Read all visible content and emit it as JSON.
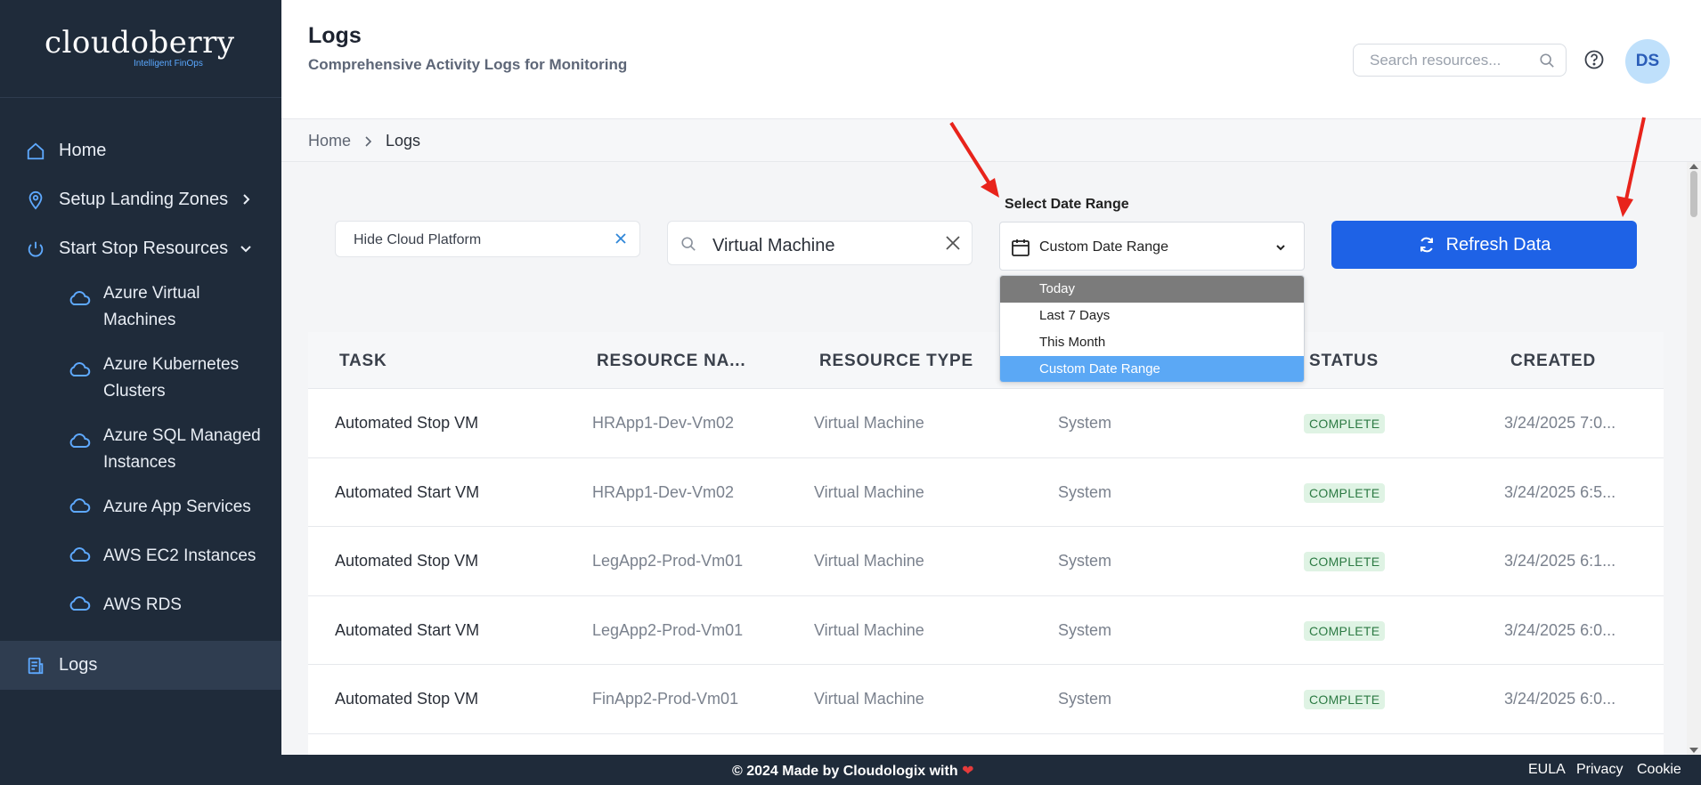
{
  "brand": {
    "name": "cloudoberry",
    "tagline": "Intelligent FinOps"
  },
  "sidebar": {
    "items": [
      {
        "label": "Home",
        "icon": "home-icon"
      },
      {
        "label": "Setup Landing Zones",
        "icon": "location-pin-icon"
      },
      {
        "label": "Start Stop Resources",
        "icon": "power-icon"
      }
    ],
    "sub_items": [
      {
        "label": "Azure Virtual Machines",
        "icon": "cloud-icon"
      },
      {
        "label": "Azure Kubernetes Clusters",
        "icon": "cloud-icon"
      },
      {
        "label": "Azure SQL Managed Instances",
        "icon": "cloud-icon"
      },
      {
        "label": "Azure App Services",
        "icon": "cloud-icon"
      },
      {
        "label": "AWS EC2 Instances",
        "icon": "cloud-icon"
      },
      {
        "label": "AWS RDS",
        "icon": "cloud-icon"
      }
    ],
    "logs": {
      "label": "Logs",
      "icon": "logs-icon",
      "active": true
    }
  },
  "header": {
    "title": "Logs",
    "subtitle": "Comprehensive Activity Logs for Monitoring",
    "search_placeholder": "Search resources...",
    "avatar_initials": "DS"
  },
  "breadcrumb": {
    "home": "Home",
    "current": "Logs"
  },
  "filters": {
    "platform_chip": "Hide Cloud Platform",
    "search_value": "Virtual Machine",
    "date_label": "Select Date Range",
    "date_selected": "Custom Date Range",
    "date_options": [
      "Today",
      "Last 7 Days",
      "This Month",
      "Custom Date Range"
    ],
    "refresh_label": "Refresh Data"
  },
  "table": {
    "columns": [
      "TASK",
      "RESOURCE NA...",
      "RESOURCE TYPE",
      "STATUS",
      "CREATED"
    ],
    "rows": [
      {
        "task": "Automated Stop VM",
        "resource": "HRApp1-Dev-Vm02",
        "type": "Virtual Machine",
        "user": "System",
        "status": "COMPLETE",
        "created": "3/24/2025 7:0..."
      },
      {
        "task": "Automated Start VM",
        "resource": "HRApp1-Dev-Vm02",
        "type": "Virtual Machine",
        "user": "System",
        "status": "COMPLETE",
        "created": "3/24/2025 6:5..."
      },
      {
        "task": "Automated Stop VM",
        "resource": "LegApp2-Prod-Vm01",
        "type": "Virtual Machine",
        "user": "System",
        "status": "COMPLETE",
        "created": "3/24/2025 6:1..."
      },
      {
        "task": "Automated Start VM",
        "resource": "LegApp2-Prod-Vm01",
        "type": "Virtual Machine",
        "user": "System",
        "status": "COMPLETE",
        "created": "3/24/2025 6:0..."
      },
      {
        "task": "Automated Stop VM",
        "resource": "FinApp2-Prod-Vm01",
        "type": "Virtual Machine",
        "user": "System",
        "status": "COMPLETE",
        "created": "3/24/2025 6:0..."
      }
    ]
  },
  "footer": {
    "copyright": "© 2024 Made by Cloudologix with",
    "heart": "❤",
    "links": [
      "EULA",
      "Privacy",
      "Cookie"
    ]
  },
  "colors": {
    "sidebar_bg": "#1f2b3a",
    "accent": "#1e62e6",
    "selected_option": "#5ba8f5",
    "status_badge_bg": "#dff3e4",
    "status_badge_text": "#2c7a43",
    "annotation_arrow": "#e8231b"
  }
}
